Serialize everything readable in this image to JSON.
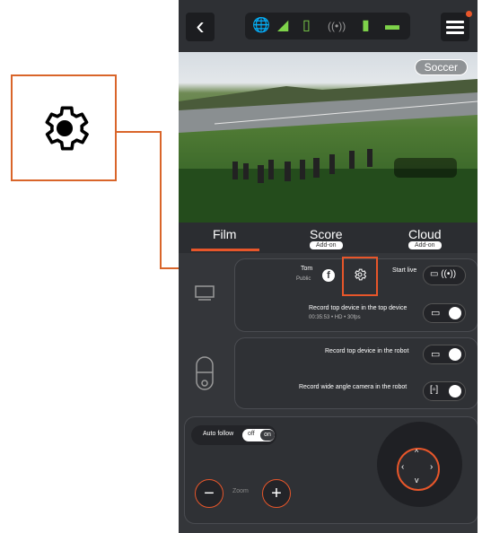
{
  "callout": {
    "icon": "gear-icon",
    "color": "#d9652a"
  },
  "topbar": {
    "back_icon": "chevron-left-icon",
    "status_icons": [
      "globe-icon",
      "signal-icon",
      "phone-battery-icon",
      "broadcast-icon",
      "robot-battery-icon",
      "device-icon"
    ],
    "menu_icon": "hamburger-menu-icon"
  },
  "video": {
    "sport_label": "Soccer"
  },
  "tabs": [
    {
      "label": "Film",
      "badge": ""
    },
    {
      "label": "Score",
      "badge": "Add-on"
    },
    {
      "label": "Cloud",
      "badge": "Add-on"
    }
  ],
  "live": {
    "account_label": "Tom",
    "visibility_label": "Public",
    "start_live_label": "Start live"
  },
  "record_top": {
    "label": "Record top device in the top device",
    "meta": "00:35:53 • HD • 30fps"
  },
  "record_robot": {
    "label": "Record top device in the robot"
  },
  "record_wide": {
    "label": "Record wide angle camera in the robot"
  },
  "controls": {
    "auto_follow_label": "Auto follow",
    "toggle_off": "off",
    "toggle_on": "on",
    "zoom_label": "Zoom",
    "zoom_minus": "−",
    "zoom_plus": "+"
  },
  "colors": {
    "accent": "#e8562a",
    "callout": "#d9652a",
    "background": "#34363a"
  }
}
